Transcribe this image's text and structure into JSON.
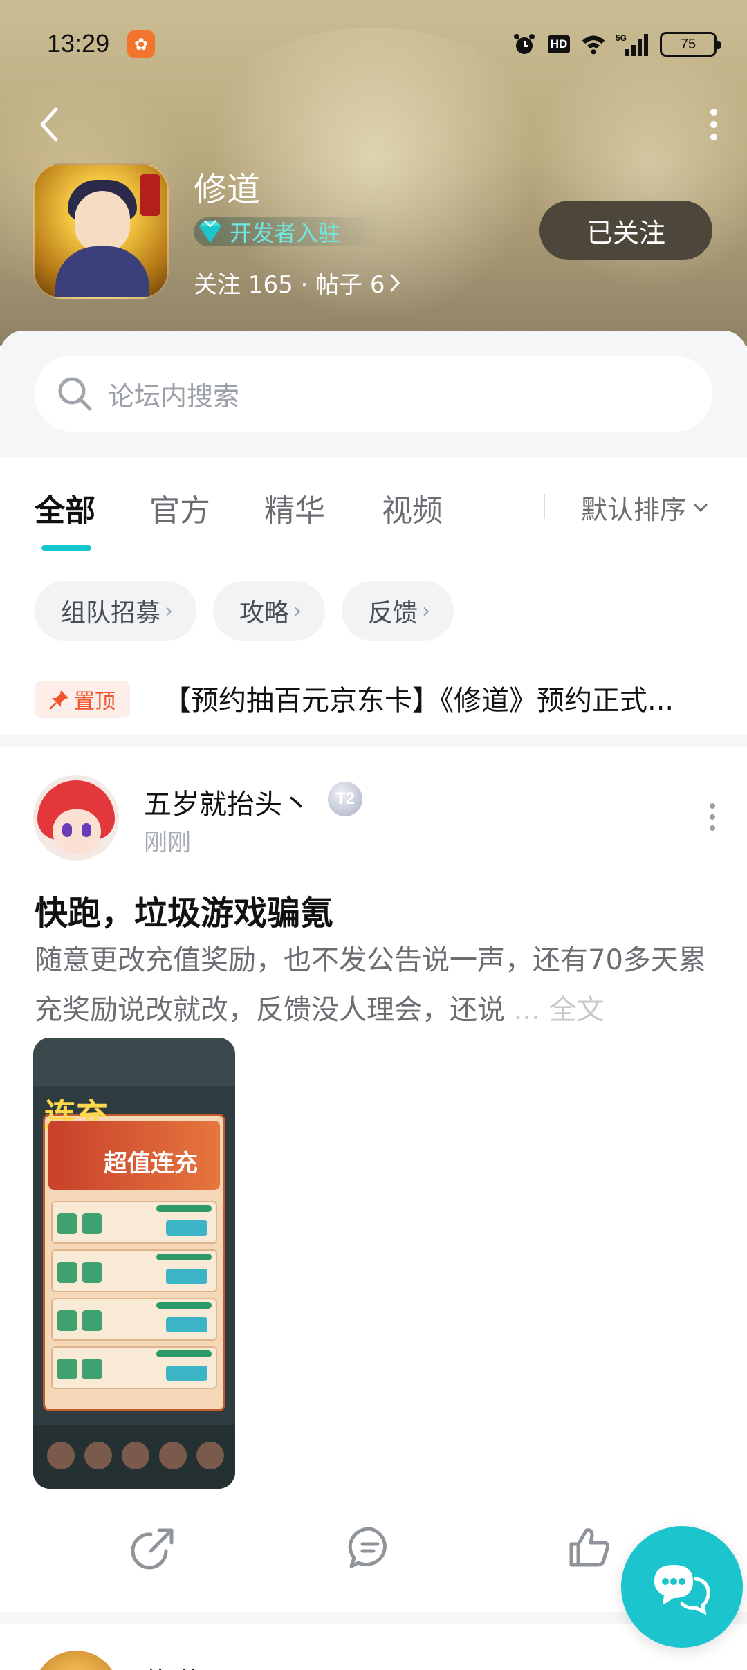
{
  "status_bar": {
    "time": "13:29",
    "battery": "75",
    "hd": "HD",
    "network": "5G"
  },
  "header": {
    "forum_name": "修道",
    "developer_badge": "开发者入驻",
    "stats": "关注 165 · 帖子 6",
    "follow_button": "已关注"
  },
  "search": {
    "placeholder": "论坛内搜索"
  },
  "tabs": [
    {
      "label": "全部",
      "active": true
    },
    {
      "label": "官方",
      "active": false
    },
    {
      "label": "精华",
      "active": false
    },
    {
      "label": "视频",
      "active": false
    }
  ],
  "sort": {
    "label": "默认排序"
  },
  "chips": [
    {
      "label": "组队招募"
    },
    {
      "label": "攻略"
    },
    {
      "label": "反馈"
    }
  ],
  "pinned": {
    "badge": "置顶",
    "title": "【预约抽百元京东卡】《修道》预约正式..."
  },
  "post": {
    "username": "五岁就抬头丶",
    "level": "T2",
    "time": "刚刚",
    "title": "快跑，垃圾游戏骗氪",
    "excerpt": "随意更改充值奖励，也不发公告说一声，还有70多天累充奖励说改就改，反馈没人理会，还说",
    "ellipsis": "...",
    "read_more": "全文",
    "image": {
      "logo_text": "连充",
      "banner_text": "超值连充"
    }
  },
  "next_post": {
    "username": "修道"
  },
  "colors": {
    "accent": "#15c5ce",
    "pin_red": "#f0552b",
    "follow_bg": "#4d463a",
    "dev_badge_text": "#6fe8e2"
  },
  "icons": {
    "back": "chevron-left-icon",
    "more": "more-vertical-icon",
    "search": "search-icon",
    "pin": "pin-icon",
    "share": "share-icon",
    "comment": "comment-icon",
    "like": "thumbs-up-icon",
    "fab": "chat-bubble-icon"
  }
}
